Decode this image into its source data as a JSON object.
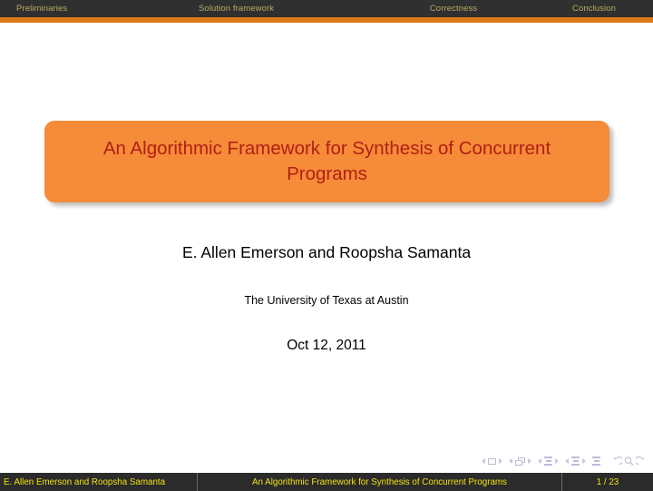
{
  "header": {
    "sections": [
      {
        "label": "Preliminaries"
      },
      {
        "label": "Solution framework"
      },
      {
        "label": "Correctness"
      },
      {
        "label": "Conclusion"
      }
    ],
    "rule_color": "#dc7a18",
    "bar_color": "#303030",
    "text_color": "#b5ad63"
  },
  "title_block": {
    "title": "An Algorithmic Framework for Synthesis of Concurrent Programs",
    "box_color": "#f68b39",
    "title_color": "#b02013"
  },
  "authors": "E. Allen Emerson and Roopsha Samanta",
  "institute": "The University of Texas at Austin",
  "date": "Oct 12, 2011",
  "nav_symbols": {
    "items": [
      {
        "icon": "slide-nav-icon",
        "title": "Slide navigation"
      },
      {
        "icon": "frame-nav-icon",
        "title": "Frame navigation"
      },
      {
        "icon": "subsection-nav-icon",
        "title": "Subsection navigation"
      },
      {
        "icon": "section-nav-icon",
        "title": "Section navigation"
      },
      {
        "icon": "presentation-nav-icon",
        "title": "Presentation navigation"
      }
    ],
    "buttons": [
      {
        "icon": "back-arrow-icon",
        "title": "Back"
      },
      {
        "icon": "search-magnifier-icon",
        "title": "Find"
      },
      {
        "icon": "forward-arrow-icon",
        "title": "Forward"
      }
    ],
    "color": "#bcbcd8"
  },
  "footer": {
    "author": "E. Allen Emerson and Roopsha Samanta",
    "title": "An Algorithmic Framework for Synthesis of Concurrent Programs",
    "page": "1 / 23",
    "bar_color": "#2b2b2b",
    "text_color": "#f2e113"
  }
}
